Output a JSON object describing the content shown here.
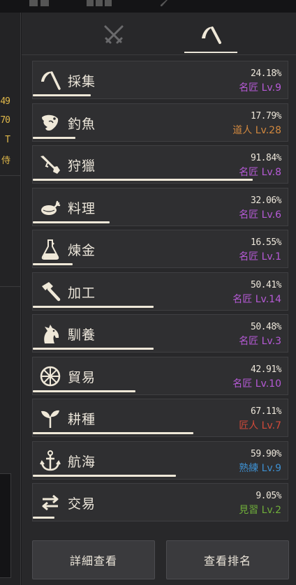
{
  "left_stats": [
    "49",
    "70",
    "T",
    "侍"
  ],
  "tabs": [
    {
      "icon": "crossed-swords-icon"
    },
    {
      "icon": "sickle-icon"
    }
  ],
  "skills": [
    {
      "name": "採集",
      "icon": "sickle-icon",
      "percent": "24.18%",
      "level": "名匠 Lv.9",
      "level_color": "#b65ad6",
      "progress": 0.2418
    },
    {
      "name": "釣魚",
      "icon": "fish-icon",
      "percent": "17.79%",
      "level": "道人 Lv.28",
      "level_color": "#d1883f",
      "progress": 0.1779
    },
    {
      "name": "狩獵",
      "icon": "rifle-icon",
      "percent": "91.84%",
      "level": "名匠 Lv.8",
      "level_color": "#b65ad6",
      "progress": 0.9184
    },
    {
      "name": "料理",
      "icon": "roast-chicken-icon",
      "percent": "32.06%",
      "level": "名匠 Lv.6",
      "level_color": "#b65ad6",
      "progress": 0.3206
    },
    {
      "name": "煉金",
      "icon": "flask-icon",
      "percent": "16.55%",
      "level": "名匠 Lv.1",
      "level_color": "#b65ad6",
      "progress": 0.1655
    },
    {
      "name": "加工",
      "icon": "hammer-icon",
      "percent": "50.41%",
      "level": "名匠 Lv.14",
      "level_color": "#b65ad6",
      "progress": 0.5041
    },
    {
      "name": "馴養",
      "icon": "horse-head-icon",
      "percent": "50.48%",
      "level": "名匠 Lv.3",
      "level_color": "#b65ad6",
      "progress": 0.5048
    },
    {
      "name": "貿易",
      "icon": "wheel-icon",
      "percent": "42.91%",
      "level": "名匠 Lv.10",
      "level_color": "#b65ad6",
      "progress": 0.4291
    },
    {
      "name": "耕種",
      "icon": "sprout-icon",
      "percent": "67.11%",
      "level": "匠人 Lv.7",
      "level_color": "#d24a3a",
      "progress": 0.6711
    },
    {
      "name": "航海",
      "icon": "anchor-icon",
      "percent": "59.90%",
      "level": "熟練 Lv.9",
      "level_color": "#3e8fd0",
      "progress": 0.599
    },
    {
      "name": "交易",
      "icon": "exchange-arrows-icon",
      "percent": "9.05%",
      "level": "見習 Lv.2",
      "level_color": "#6fae3a",
      "progress": 0.0905
    }
  ],
  "buttons": {
    "details": "詳細查看",
    "ranking": "查看排名"
  }
}
